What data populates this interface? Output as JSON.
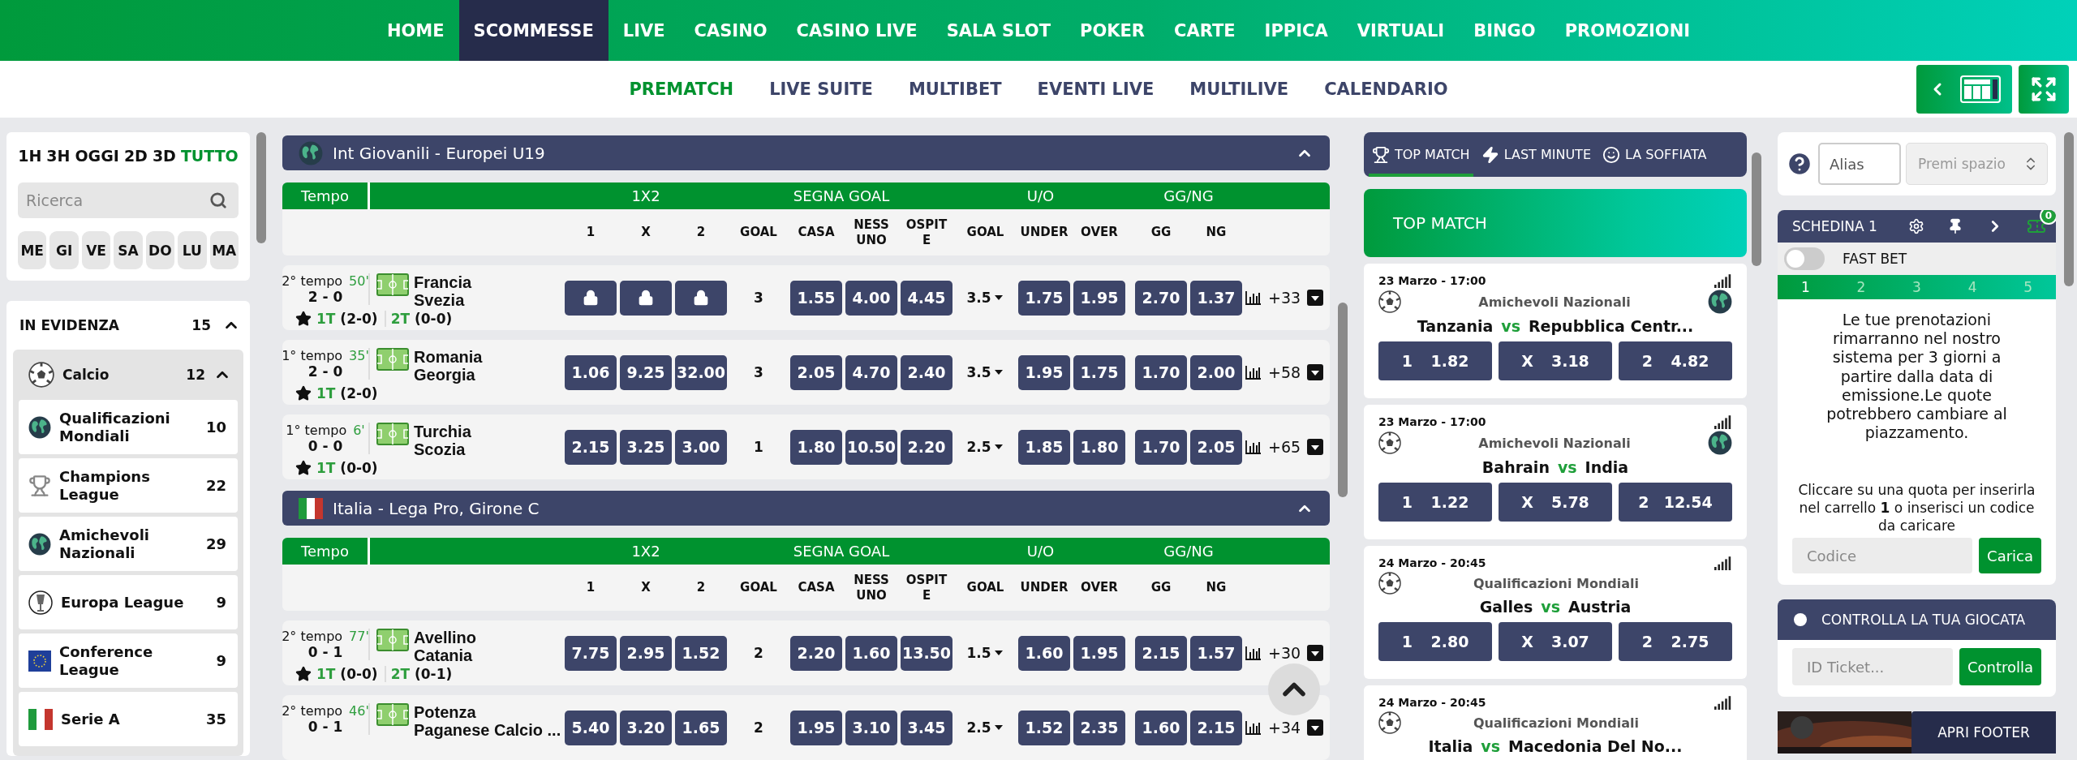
{
  "nav": {
    "items": [
      {
        "label": "HOME",
        "selected": false
      },
      {
        "label": "SCOMMESSE",
        "selected": true
      },
      {
        "label": "LIVE",
        "selected": false
      },
      {
        "label": "CASINO",
        "selected": false
      },
      {
        "label": "CASINO LIVE",
        "selected": false
      },
      {
        "label": "SALA SLOT",
        "selected": false
      },
      {
        "label": "POKER",
        "selected": false
      },
      {
        "label": "CARTE",
        "selected": false
      },
      {
        "label": "IPPICA",
        "selected": false
      },
      {
        "label": "VIRTUALI",
        "selected": false
      },
      {
        "label": "BINGO",
        "selected": false
      },
      {
        "label": "PROMOZIONI",
        "selected": false
      }
    ]
  },
  "subnav": {
    "items": [
      {
        "label": "PREMATCH",
        "selected": true
      },
      {
        "label": "LIVE SUITE",
        "selected": false
      },
      {
        "label": "MULTIBET",
        "selected": false
      },
      {
        "label": "EVENTI LIVE",
        "selected": false
      },
      {
        "label": "MULTILIVE",
        "selected": false
      },
      {
        "label": "CALENDARIO",
        "selected": false
      }
    ]
  },
  "sidebar": {
    "time_filters": [
      {
        "label": "1H",
        "selected": false
      },
      {
        "label": "3H",
        "selected": false
      },
      {
        "label": "OGGI",
        "selected": false
      },
      {
        "label": "2D",
        "selected": false
      },
      {
        "label": "3D",
        "selected": false
      },
      {
        "label": "TUTTO",
        "selected": true
      }
    ],
    "search": {
      "placeholder": "Ricerca"
    },
    "days": [
      "ME",
      "GI",
      "VE",
      "SA",
      "DO",
      "LU",
      "MA"
    ],
    "featured": {
      "title": "IN EVIDENZA",
      "count": "15",
      "expanded": true,
      "sport": {
        "name": "Calcio",
        "count": "12",
        "expanded": true,
        "competitions": [
          {
            "name": "Qualificazioni Mondiali",
            "count": "10",
            "kind": "world"
          },
          {
            "name": "Champions League",
            "count": "22",
            "kind": "cup"
          },
          {
            "name": "Amichevoli Nazionali",
            "count": "29",
            "kind": "world"
          },
          {
            "name": "Europa League",
            "count": "9",
            "kind": "europa"
          },
          {
            "name": "Conference League",
            "count": "9",
            "kind": "europe"
          },
          {
            "name": "Serie A",
            "count": "35",
            "kind": "italy"
          }
        ]
      }
    }
  },
  "events": {
    "sections": [
      {
        "title": "Int Giovanili - Europei U19",
        "kind": "world",
        "expanded": true,
        "groups": [
          "Tempo",
          "1X2",
          "SEGNA GOAL",
          "U/O",
          "GG/NG"
        ],
        "columns": [
          "1",
          "X",
          "2",
          "GOAL",
          "CASA",
          "NESSUNO",
          "OSPITE",
          "GOAL",
          "UNDER",
          "OVER",
          "GG",
          "NG"
        ],
        "matches": [
          {
            "period": "2° tempo",
            "minute": "50'",
            "score": "2 - 0",
            "home": "Francia",
            "away": "Svezia",
            "halves": [
              {
                "label": "1T",
                "score": "(2-0)"
              },
              {
                "label": "2T",
                "score": "(0-0)"
              }
            ],
            "odds_1x2": [
              {
                "locked": true
              },
              {
                "locked": true
              },
              {
                "locked": true
              }
            ],
            "goal": "3",
            "segna_goal": [
              "1.55",
              "4.00",
              "4.45"
            ],
            "uo_line": "3.5",
            "uo": [
              "1.75",
              "1.95"
            ],
            "ggng": [
              "2.70",
              "1.37"
            ],
            "more": "+33"
          },
          {
            "period": "1° tempo",
            "minute": "35'",
            "score": "2 - 0",
            "home": "Romania",
            "away": "Georgia",
            "halves": [
              {
                "label": "1T",
                "score": "(2-0)"
              }
            ],
            "odds_1x2": [
              {
                "value": "1.06",
                "locked": false
              },
              {
                "value": "9.25",
                "locked": false
              },
              {
                "value": "32.00",
                "locked": false
              }
            ],
            "goal": "3",
            "segna_goal": [
              "2.05",
              "4.70",
              "2.40"
            ],
            "uo_line": "3.5",
            "uo": [
              "1.95",
              "1.75"
            ],
            "ggng": [
              "1.70",
              "2.00"
            ],
            "more": "+58"
          },
          {
            "period": "1° tempo",
            "minute": "6'",
            "score": "0 - 0",
            "home": "Turchia",
            "away": "Scozia",
            "halves": [
              {
                "label": "1T",
                "score": "(0-0)"
              }
            ],
            "odds_1x2": [
              {
                "value": "2.15",
                "locked": false
              },
              {
                "value": "3.25",
                "locked": false
              },
              {
                "value": "3.00",
                "locked": false
              }
            ],
            "goal": "1",
            "segna_goal": [
              "1.80",
              "10.50",
              "2.20"
            ],
            "uo_line": "2.5",
            "uo": [
              "1.85",
              "1.80"
            ],
            "ggng": [
              "1.70",
              "2.05"
            ],
            "more": "+65"
          }
        ]
      },
      {
        "title": "Italia - Lega Pro, Girone C",
        "kind": "italy",
        "expanded": true,
        "groups": [
          "Tempo",
          "1X2",
          "SEGNA GOAL",
          "U/O",
          "GG/NG"
        ],
        "columns": [
          "1",
          "X",
          "2",
          "GOAL",
          "CASA",
          "NESSUNO",
          "OSPITE",
          "GOAL",
          "UNDER",
          "OVER",
          "GG",
          "NG"
        ],
        "matches": [
          {
            "period": "2° tempo",
            "minute": "77'",
            "score": "0 - 1",
            "home": "Avellino",
            "away": "Catania",
            "halves": [
              {
                "label": "1T",
                "score": "(0-0)"
              },
              {
                "label": "2T",
                "score": "(0-1)"
              }
            ],
            "odds_1x2": [
              {
                "value": "7.75",
                "locked": false
              },
              {
                "value": "2.95",
                "locked": false
              },
              {
                "value": "1.52",
                "locked": false
              }
            ],
            "goal": "2",
            "segna_goal": [
              "2.20",
              "1.60",
              "13.50"
            ],
            "uo_line": "1.5",
            "uo": [
              "1.60",
              "1.95"
            ],
            "ggng": [
              "2.15",
              "1.57"
            ],
            "more": "+30"
          },
          {
            "period": "2° tempo",
            "minute": "46'",
            "score": "0 - 1",
            "home": "Potenza",
            "away": "Paganese Calcio ...",
            "odds_1x2": [
              {
                "value": "5.40",
                "locked": false
              },
              {
                "value": "3.20",
                "locked": false
              },
              {
                "value": "1.65",
                "locked": false
              }
            ],
            "goal": "2",
            "segna_goal": [
              "1.95",
              "3.10",
              "3.45"
            ],
            "uo_line": "2.5",
            "uo": [
              "1.52",
              "2.35"
            ],
            "ggng": [
              "1.60",
              "2.15"
            ],
            "more": "+34"
          }
        ]
      }
    ]
  },
  "top_match": {
    "tabs": [
      {
        "label": "TOP MATCH",
        "kind": "trophy",
        "selected": true
      },
      {
        "label": "LAST MINUTE",
        "kind": "bolt",
        "selected": false
      },
      {
        "label": "LA SOFFIATA",
        "kind": "smile",
        "selected": false
      }
    ],
    "banner": "TOP MATCH",
    "matches": [
      {
        "date": "23 Marzo - 17:00",
        "competition": "Amichevoli Nazionali",
        "kind": "world",
        "home": "Tanzania",
        "vs": "vs",
        "away": "Repubblica Centr...",
        "odds": [
          {
            "label": "1",
            "value": "1.82"
          },
          {
            "label": "X",
            "value": "3.18"
          },
          {
            "label": "2",
            "value": "4.82"
          }
        ]
      },
      {
        "date": "23 Marzo - 17:00",
        "competition": "Amichevoli Nazionali",
        "kind": "world",
        "home": "Bahrain",
        "vs": "vs",
        "away": "India",
        "odds": [
          {
            "label": "1",
            "value": "1.22"
          },
          {
            "label": "X",
            "value": "5.78"
          },
          {
            "label": "2",
            "value": "12.54"
          }
        ]
      },
      {
        "date": "24 Marzo - 20:45",
        "competition": "Qualificazioni Mondiali",
        "kind": "plain",
        "home": "Galles",
        "vs": "vs",
        "away": "Austria",
        "odds": [
          {
            "label": "1",
            "value": "2.80"
          },
          {
            "label": "X",
            "value": "3.07"
          },
          {
            "label": "2",
            "value": "2.75"
          }
        ]
      },
      {
        "date": "24 Marzo - 20:45",
        "competition": "Qualificazioni Mondiali",
        "kind": "plain",
        "home": "Italia",
        "vs": "vs",
        "away": "Macedonia Del No..."
      }
    ]
  },
  "betslip": {
    "alias": {
      "placeholder": "Alias"
    },
    "prize": {
      "placeholder": "Premi spazio"
    },
    "title": "SCHEDINA 1",
    "badge": "0",
    "fast_bet": {
      "label": "FAST BET",
      "on": false
    },
    "tabs": [
      {
        "label": "1",
        "selected": true
      },
      {
        "label": "2",
        "selected": false
      },
      {
        "label": "3",
        "selected": false
      },
      {
        "label": "4",
        "selected": false
      },
      {
        "label": "5",
        "selected": false
      }
    ],
    "message": "Le tue prenotazioni rimarranno nel nostro sistema per 3 giorni a partire dalla data di emissione.Le quote potrebbero cambiare al piazzamento.",
    "instructions": "Cliccare su una quota per inserirla nel carrello **1** o inserisci un codice da caricare",
    "code": {
      "placeholder": "Codice",
      "button": "Carica"
    }
  },
  "check": {
    "title": "CONTROLLA LA TUA GIOCATA",
    "placeholder": "ID Ticket...",
    "button": "Controlla"
  },
  "footer": {
    "button": "APRI FOOTER"
  }
}
